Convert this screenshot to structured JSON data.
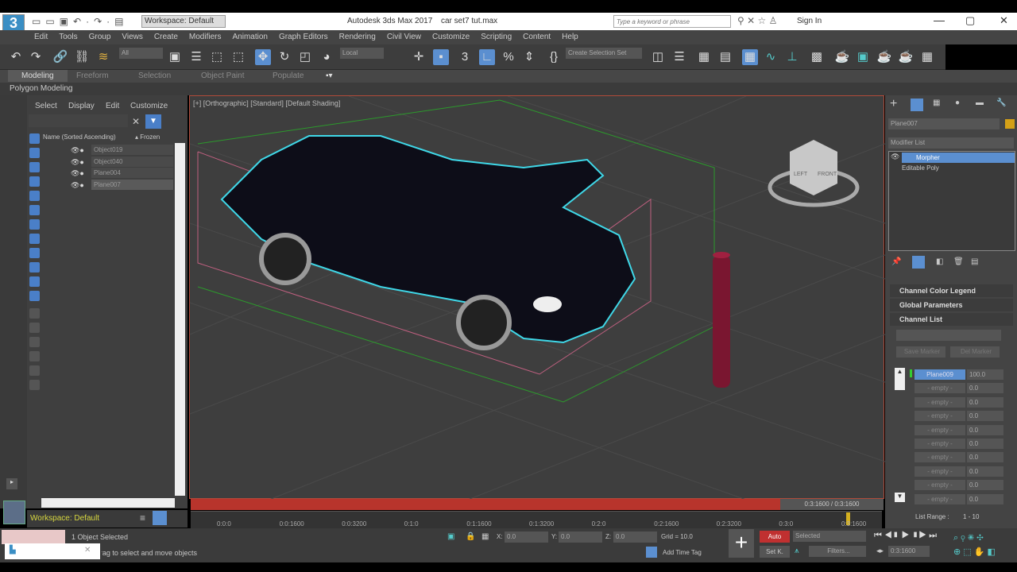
{
  "app": {
    "logo": "3",
    "title": "Autodesk 3ds Max 2017",
    "file": "car set7 tut.max",
    "workspace": "Workspace: Default",
    "search_placeholder": "Type a keyword or phrase",
    "sign_in": "Sign In"
  },
  "menu": [
    "Edit",
    "Tools",
    "Group",
    "Views",
    "Create",
    "Modifiers",
    "Animation",
    "Graph Editors",
    "Rendering",
    "Civil View",
    "Customize",
    "Scripting",
    "Content",
    "Help"
  ],
  "toolbar": {
    "filter": "All",
    "coord": "Local",
    "selection_set": "Create Selection Set"
  },
  "ribbon": {
    "tabs": [
      "Modeling",
      "Freeform",
      "Selection",
      "Object Paint",
      "Populate"
    ],
    "sub": "Polygon Modeling"
  },
  "explorer": {
    "menu": [
      "Select",
      "Display",
      "Edit",
      "Customize"
    ],
    "col_name": "Name (Sorted Ascending)",
    "col_frozen": "▴ Frozen",
    "items": [
      "Object019",
      "Object040",
      "Plane004",
      "Plane007"
    ],
    "workspace": "Workspace: Default"
  },
  "viewport": {
    "label": "[+] [Orthographic] [Standard] [Default Shading]",
    "cube_left": "LEFT",
    "cube_front": "FRONT"
  },
  "cmd": {
    "object_name": "Plane007",
    "object_color": "#d4a017",
    "modifier_list": "Modifier List",
    "stack": [
      "Morpher",
      "Editable Poly"
    ],
    "rollouts": [
      "Channel Color Legend",
      "Global Parameters",
      "Channel List"
    ],
    "save_marker": "Save Marker",
    "del_marker": "Del Marker",
    "channels": [
      {
        "name": "Plane009",
        "value": "100.0"
      },
      {
        "name": "- empty -",
        "value": "0.0"
      },
      {
        "name": "- empty -",
        "value": "0.0"
      },
      {
        "name": "- empty -",
        "value": "0.0"
      },
      {
        "name": "- empty -",
        "value": "0.0"
      },
      {
        "name": "- empty -",
        "value": "0.0"
      },
      {
        "name": "- empty -",
        "value": "0.0"
      },
      {
        "name": "- empty -",
        "value": "0.0"
      },
      {
        "name": "- empty -",
        "value": "0.0"
      },
      {
        "name": "- empty -",
        "value": "0.0"
      }
    ],
    "list_range_label": "List Range :",
    "list_range": "1 - 10"
  },
  "timeline": {
    "slider": "0:3:1600 / 0:3:1600",
    "ticks": [
      "0:0:0",
      "0:0:1600",
      "0:0:3200",
      "0:1:0",
      "0:1:1600",
      "0:1:3200",
      "0:2:0",
      "0:2:1600",
      "0:2:3200",
      "0:3:0",
      "0:3:1600"
    ]
  },
  "status": {
    "selected": "1 Object Selected",
    "prompt": "Drag to select and move objects",
    "x": "0.0",
    "y": "0.0",
    "z": "0.0",
    "grid": "Grid = 10.0",
    "add_time_tag": "Add Time Tag",
    "auto": "Auto",
    "set_key": "Set K.",
    "key_filter": "Selected",
    "filters": "Filters...",
    "current_time": "0:3:1600"
  }
}
